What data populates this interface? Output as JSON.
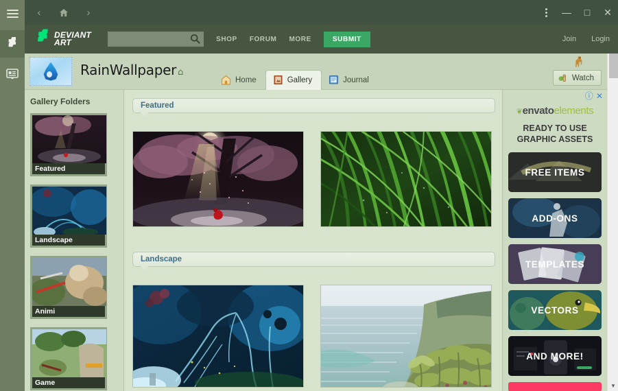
{
  "window": {
    "rail": [
      {
        "name": "menu",
        "icon": "hamburger-icon",
        "active": false
      },
      {
        "name": "deviantart",
        "icon": "deviantart-logo-icon",
        "active": true
      },
      {
        "name": "reader",
        "icon": "browser-window-icon",
        "active": false
      }
    ],
    "nav": {
      "back": "‹",
      "home": "⌂",
      "forward": "›"
    },
    "controls": {
      "menu": "more-vertical-icon",
      "minimize": "—",
      "maximize": "□",
      "close": "✕"
    }
  },
  "site_header": {
    "brand_mark": "≠",
    "brand_line1": "DEVIANT",
    "brand_line2": "ART",
    "search": {
      "value": "",
      "placeholder": "",
      "icon": "search-icon"
    },
    "links": [
      "SHOP",
      "FORUM",
      "MORE"
    ],
    "submit_label": "SUBMIT",
    "account": [
      "Join",
      "Login"
    ],
    "accent_green": "#00e57a",
    "submit_green": "#3aa864"
  },
  "profile": {
    "avatar_icon": "water-droplet-icon",
    "title": "RainWallpaper",
    "home_icon": "⌂",
    "tabs": [
      {
        "label": "Home",
        "icon": "home-icon",
        "active": false
      },
      {
        "label": "Gallery",
        "icon": "gallery-icon",
        "active": true
      },
      {
        "label": "Journal",
        "icon": "journal-icon",
        "active": false
      }
    ],
    "llama_icon": "llama-badge-icon",
    "watch_label": "Watch",
    "watch_icon": "watch-binoculars-icon"
  },
  "sidebar": {
    "title": "Gallery Folders",
    "folders": [
      {
        "label": "Featured"
      },
      {
        "label": "Landscape"
      },
      {
        "label": "Animi"
      },
      {
        "label": "Game"
      }
    ]
  },
  "gallery": {
    "sections": [
      {
        "title": "Featured",
        "items": [
          {
            "alt": "cherry blossom tree at night"
          },
          {
            "alt": "green grass blades close up"
          }
        ]
      },
      {
        "title": "Landscape",
        "items": [
          {
            "alt": "blue glowing fantasy forest"
          },
          {
            "alt": "tropical beach with palm trees"
          }
        ]
      }
    ]
  },
  "ad": {
    "info_icon": "ⓘ",
    "close_icon": "✕",
    "brand_leaf": "❦",
    "brand_bold": "envato",
    "brand_light": "elements",
    "headline_line1": "READY TO USE",
    "headline_line2": "GRAPHIC ASSETS",
    "cards": [
      {
        "label": "FREE ITEMS",
        "color": "#2c2e2b"
      },
      {
        "label": "ADD-ONS",
        "color": "#1d3246"
      },
      {
        "label": "TEMPLATES",
        "color": "#4a3f58"
      },
      {
        "label": "VECTORS",
        "color": "#1f5a5e"
      },
      {
        "label": "AND MORE!",
        "color": "#121318"
      }
    ],
    "footer_color": "#fb3b64"
  },
  "scrollbar": {
    "up": "▲",
    "down": "▼"
  }
}
